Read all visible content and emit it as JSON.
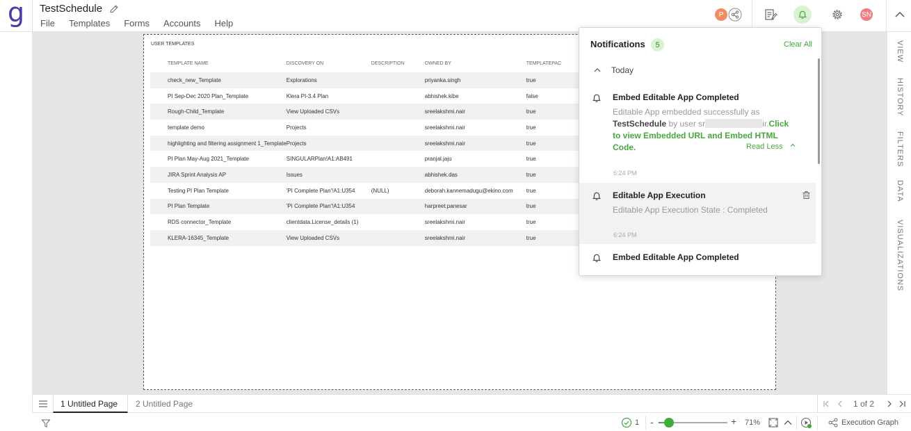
{
  "header": {
    "logo": "g",
    "app_title": "TestSchedule",
    "menu": [
      "File",
      "Templates",
      "Forms",
      "Accounts",
      "Help"
    ],
    "avatar_p": "P",
    "avatar_user": "SN"
  },
  "templates": {
    "heading": "USER TEMPLATES",
    "columns": [
      "TEMPLATE NAME",
      "DISCOVERY ON",
      "DESCRIPTION",
      "OWNED BY",
      "TEMPLATEPAC"
    ],
    "rows": [
      [
        "check_new_Template",
        "Explorations",
        "",
        "priyanka.singh",
        "true"
      ],
      [
        "PI Sep-Dec 2020 Plan_Template",
        "Klera PI-3.4 Plan",
        "",
        "abhishek.kibe",
        "false"
      ],
      [
        "Rough-Child_Template",
        "View Uploaded CSVs",
        "",
        "sreelakshmi.nair",
        "true"
      ],
      [
        "template demo",
        "Projects",
        "",
        "sreelakshmi.nair",
        "true"
      ],
      [
        "highlighting and filtering assignment 1_Template",
        "Projects",
        "",
        "sreelakshmi.nair",
        "true"
      ],
      [
        "PI Plan May-Aug 2021_Template",
        "SINGULARPlan!A1:AB491",
        "",
        "pranjal.jaju",
        "true"
      ],
      [
        "JIRA Sprint Analysis AP",
        "Issues",
        "",
        "abhishek.das",
        "true"
      ],
      [
        "Testing PI Plan Template",
        "'PI Complete Plan'!A1:U354",
        "(NULL)",
        "deborah.kannemadugu@ekino.com",
        "true"
      ],
      [
        "PI Plan Template",
        "'PI Complete Plan'!A1:U354",
        "",
        "harpreet.panesar",
        "true"
      ],
      [
        "RDS connector_Template",
        "clientdata.License_details (1)",
        "",
        "sreelakshmi.nair",
        "true"
      ],
      [
        "KLERA-16345_Template",
        "View Uploaded CSVs",
        "",
        "sreelakshmi.nair",
        "true"
      ]
    ]
  },
  "right_tabs": [
    "VIEW",
    "HISTORY",
    "FILTERS",
    "DATA",
    "VISUALIZATIONS"
  ],
  "pages": {
    "tab1": "1 Untitled Page",
    "tab2": "2 Untitled Page",
    "pager": "1 of 2"
  },
  "status": {
    "check_count": "1",
    "zoom": "71%",
    "zoom_level": 0.15,
    "execution_graph": "Execution Graph"
  },
  "notifications": {
    "title": "Notifications",
    "count": "5",
    "clear_all": "Clear All",
    "section": "Today",
    "items": [
      {
        "title": "Embed Editable App Completed",
        "body_pre": "Editable App embedded successfully as ",
        "body_app": "TestSchedule",
        "body_mid": " by user sr",
        "body_post_user": "ir.",
        "body_link": "Click to view Embedded URL and Embed HTML Code.",
        "read_less": "Read Less",
        "time": "6:24 PM"
      },
      {
        "title": "Editable App Execution",
        "body": "Editable App Execution State : Completed",
        "time": "6:24 PM"
      },
      {
        "title": "Embed Editable App Completed"
      }
    ]
  },
  "colors": {
    "accent_green": "#45a83a",
    "logo_purple": "#4b3aa8",
    "avatar_p": "#f08c64",
    "avatar_sn": "#f07c84"
  }
}
